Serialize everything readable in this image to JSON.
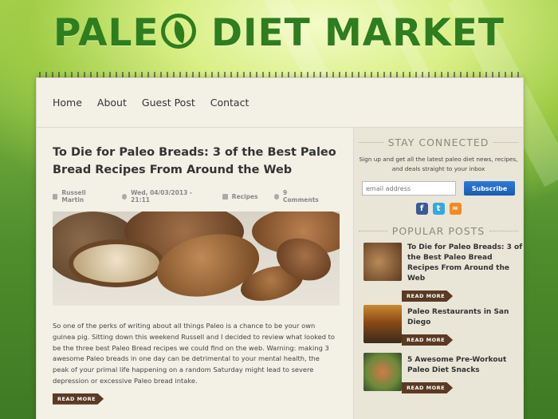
{
  "site": {
    "logo_part1": "PALE",
    "logo_part2": "DIET MARKET"
  },
  "nav": [
    "Home",
    "About",
    "Guest Post",
    "Contact"
  ],
  "post": {
    "title": "To Die for Paleo Breads: 3 of the Best Paleo Bread Recipes From Around the Web",
    "author": "Russell Martin",
    "date": "Wed, 04/03/2013 - 21:11",
    "category": "Recipes",
    "comments": "9 Comments",
    "excerpt": "So one of the perks of writing about all things Paleo is a chance to be your own guinea pig. Sitting down this weekend Russell and I decided to review what looked to be the three best Paleo Bread recipes we could find on the web. Warning: making 3 awesome Paleo breads in one day can be detrimental to your mental health, the peak of your primal life happening on a random Saturday might lead to severe depression or excessive Paleo bread intake.",
    "read_more": "READ MORE"
  },
  "sidebar": {
    "stay_connected": "STAY CONNECTED",
    "signup_text": "Sign up and get all the latest paleo diet news, recipes, and deals straight to your inbox",
    "email_placeholder": "email address",
    "subscribe": "Subscribe",
    "popular_heading": "POPULAR POSTS",
    "popular": [
      {
        "title": "To Die for Paleo Breads: 3 of the Best Paleo Bread Recipes From Around the Web",
        "read_more": "READ MORE"
      },
      {
        "title": "Paleo Restaurants in San Diego",
        "read_more": "READ MORE"
      },
      {
        "title": "5 Awesome Pre-Workout Paleo Diet Snacks",
        "read_more": "READ MORE"
      }
    ]
  },
  "icons": {
    "social": [
      "facebook-icon",
      "twitter-icon",
      "rss-icon"
    ]
  },
  "colors": {
    "brand_green": "#2e7d1e",
    "read_more_brown": "#5a3a24",
    "subscribe_blue": "#1f66c2"
  }
}
